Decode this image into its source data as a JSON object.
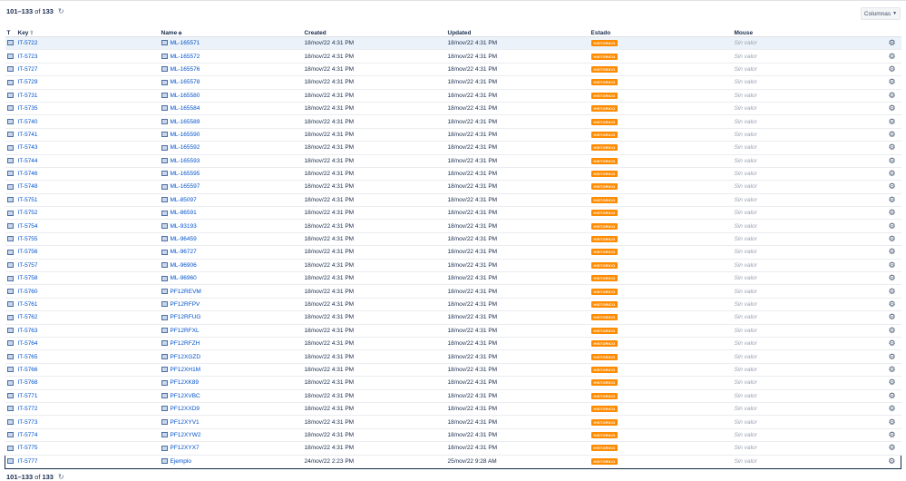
{
  "pagination": {
    "range": "101–133",
    "of": "of",
    "total": "133"
  },
  "toolbar": {
    "columns_label": "Columnas"
  },
  "columns": {
    "t": "T",
    "key": "Key",
    "name": "Name",
    "created": "Created",
    "updated": "Updated",
    "estado": "Estado",
    "mouse": "Mouse"
  },
  "rows": [
    {
      "key": "IT-5722",
      "name": "ML-165571",
      "created": "18/nov/22 4:31 PM",
      "updated": "18/nov/22 4:31 PM",
      "estado": "HISTORICO",
      "mouse": "Sin valor"
    },
    {
      "key": "IT-5723",
      "name": "ML-165572",
      "created": "18/nov/22 4:31 PM",
      "updated": "18/nov/22 4:31 PM",
      "estado": "HISTORICO",
      "mouse": "Sin valor"
    },
    {
      "key": "IT-5727",
      "name": "ML-165576",
      "created": "18/nov/22 4:31 PM",
      "updated": "18/nov/22 4:31 PM",
      "estado": "HISTORICO",
      "mouse": "Sin valor"
    },
    {
      "key": "IT-5729",
      "name": "ML-165578",
      "created": "18/nov/22 4:31 PM",
      "updated": "18/nov/22 4:31 PM",
      "estado": "HISTORICO",
      "mouse": "Sin valor"
    },
    {
      "key": "IT-5731",
      "name": "ML-165580",
      "created": "18/nov/22 4:31 PM",
      "updated": "18/nov/22 4:31 PM",
      "estado": "HISTORICO",
      "mouse": "Sin valor"
    },
    {
      "key": "IT-5735",
      "name": "ML-165584",
      "created": "18/nov/22 4:31 PM",
      "updated": "18/nov/22 4:31 PM",
      "estado": "HISTORICO",
      "mouse": "Sin valor"
    },
    {
      "key": "IT-5740",
      "name": "ML-165589",
      "created": "18/nov/22 4:31 PM",
      "updated": "18/nov/22 4:31 PM",
      "estado": "HISTORICO",
      "mouse": "Sin valor"
    },
    {
      "key": "IT-5741",
      "name": "ML-165590",
      "created": "18/nov/22 4:31 PM",
      "updated": "18/nov/22 4:31 PM",
      "estado": "HISTORICO",
      "mouse": "Sin valor"
    },
    {
      "key": "IT-5743",
      "name": "ML-165592",
      "created": "18/nov/22 4:31 PM",
      "updated": "18/nov/22 4:31 PM",
      "estado": "HISTORICO",
      "mouse": "Sin valor"
    },
    {
      "key": "IT-5744",
      "name": "ML-165593",
      "created": "18/nov/22 4:31 PM",
      "updated": "18/nov/22 4:31 PM",
      "estado": "HISTORICO",
      "mouse": "Sin valor"
    },
    {
      "key": "IT-5746",
      "name": "ML-165595",
      "created": "18/nov/22 4:31 PM",
      "updated": "18/nov/22 4:31 PM",
      "estado": "HISTORICO",
      "mouse": "Sin valor"
    },
    {
      "key": "IT-5748",
      "name": "ML-165597",
      "created": "18/nov/22 4:31 PM",
      "updated": "18/nov/22 4:31 PM",
      "estado": "HISTORICO",
      "mouse": "Sin valor"
    },
    {
      "key": "IT-5751",
      "name": "ML-85097",
      "created": "18/nov/22 4:31 PM",
      "updated": "18/nov/22 4:31 PM",
      "estado": "HISTORICO",
      "mouse": "Sin valor"
    },
    {
      "key": "IT-5752",
      "name": "ML-86591",
      "created": "18/nov/22 4:31 PM",
      "updated": "18/nov/22 4:31 PM",
      "estado": "HISTORICO",
      "mouse": "Sin valor"
    },
    {
      "key": "IT-5754",
      "name": "ML-93193",
      "created": "18/nov/22 4:31 PM",
      "updated": "18/nov/22 4:31 PM",
      "estado": "HISTORICO",
      "mouse": "Sin valor"
    },
    {
      "key": "IT-5755",
      "name": "ML-96459",
      "created": "18/nov/22 4:31 PM",
      "updated": "18/nov/22 4:31 PM",
      "estado": "HISTORICO",
      "mouse": "Sin valor"
    },
    {
      "key": "IT-5756",
      "name": "ML-96727",
      "created": "18/nov/22 4:31 PM",
      "updated": "18/nov/22 4:31 PM",
      "estado": "HISTORICO",
      "mouse": "Sin valor"
    },
    {
      "key": "IT-5757",
      "name": "ML-96906",
      "created": "18/nov/22 4:31 PM",
      "updated": "18/nov/22 4:31 PM",
      "estado": "HISTORICO",
      "mouse": "Sin valor"
    },
    {
      "key": "IT-5758",
      "name": "ML-96960",
      "created": "18/nov/22 4:31 PM",
      "updated": "18/nov/22 4:31 PM",
      "estado": "HISTORICO",
      "mouse": "Sin valor"
    },
    {
      "key": "IT-5760",
      "name": "PF12REVM",
      "created": "18/nov/22 4:31 PM",
      "updated": "18/nov/22 4:31 PM",
      "estado": "HISTORICO",
      "mouse": "Sin valor"
    },
    {
      "key": "IT-5761",
      "name": "PF12RFPV",
      "created": "18/nov/22 4:31 PM",
      "updated": "18/nov/22 4:31 PM",
      "estado": "HISTORICO",
      "mouse": "Sin valor"
    },
    {
      "key": "IT-5762",
      "name": "PF12RFUG",
      "created": "18/nov/22 4:31 PM",
      "updated": "18/nov/22 4:31 PM",
      "estado": "HISTORICO",
      "mouse": "Sin valor"
    },
    {
      "key": "IT-5763",
      "name": "PF12RFXL",
      "created": "18/nov/22 4:31 PM",
      "updated": "18/nov/22 4:31 PM",
      "estado": "HISTORICO",
      "mouse": "Sin valor"
    },
    {
      "key": "IT-5764",
      "name": "PF12RFZH",
      "created": "18/nov/22 4:31 PM",
      "updated": "18/nov/22 4:31 PM",
      "estado": "HISTORICO",
      "mouse": "Sin valor"
    },
    {
      "key": "IT-5765",
      "name": "PF12XGZD",
      "created": "18/nov/22 4:31 PM",
      "updated": "18/nov/22 4:31 PM",
      "estado": "HISTORICO",
      "mouse": "Sin valor"
    },
    {
      "key": "IT-5766",
      "name": "PF12XH1M",
      "created": "18/nov/22 4:31 PM",
      "updated": "18/nov/22 4:31 PM",
      "estado": "HISTORICO",
      "mouse": "Sin valor"
    },
    {
      "key": "IT-5768",
      "name": "PF12XK89",
      "created": "18/nov/22 4:31 PM",
      "updated": "18/nov/22 4:31 PM",
      "estado": "HISTORICO",
      "mouse": "Sin valor"
    },
    {
      "key": "IT-5771",
      "name": "PF12XVBC",
      "created": "18/nov/22 4:31 PM",
      "updated": "18/nov/22 4:31 PM",
      "estado": "HISTORICO",
      "mouse": "Sin valor"
    },
    {
      "key": "IT-5772",
      "name": "PF12XXD9",
      "created": "18/nov/22 4:31 PM",
      "updated": "18/nov/22 4:31 PM",
      "estado": "HISTORICO",
      "mouse": "Sin valor"
    },
    {
      "key": "IT-5773",
      "name": "PF12XYV1",
      "created": "18/nov/22 4:31 PM",
      "updated": "18/nov/22 4:31 PM",
      "estado": "HISTORICO",
      "mouse": "Sin valor"
    },
    {
      "key": "IT-5774",
      "name": "PF12XYW2",
      "created": "18/nov/22 4:31 PM",
      "updated": "18/nov/22 4:31 PM",
      "estado": "HISTORICO",
      "mouse": "Sin valor"
    },
    {
      "key": "IT-5775",
      "name": "PF12XYX7",
      "created": "18/nov/22 4:31 PM",
      "updated": "18/nov/22 4:31 PM",
      "estado": "HISTORICO",
      "mouse": "Sin valor"
    },
    {
      "key": "IT-5777",
      "name": "Ejemplo",
      "created": "24/nov/22 2:23 PM",
      "updated": "25/nov/22 9:28 AM",
      "estado": "HISTORICO",
      "mouse": "Sin valor",
      "selected": true
    }
  ],
  "icons": {
    "type": "issue-type-icon",
    "sort": "sort-up-arrow-icon",
    "tag": "tag-icon",
    "gear": "gear-icon",
    "refresh": "refresh-icon"
  },
  "colors": {
    "link": "#0052cc",
    "badge": "#ff8b00",
    "selected_border": "#172b4d",
    "first_row_bg": "#ebf2f9"
  }
}
